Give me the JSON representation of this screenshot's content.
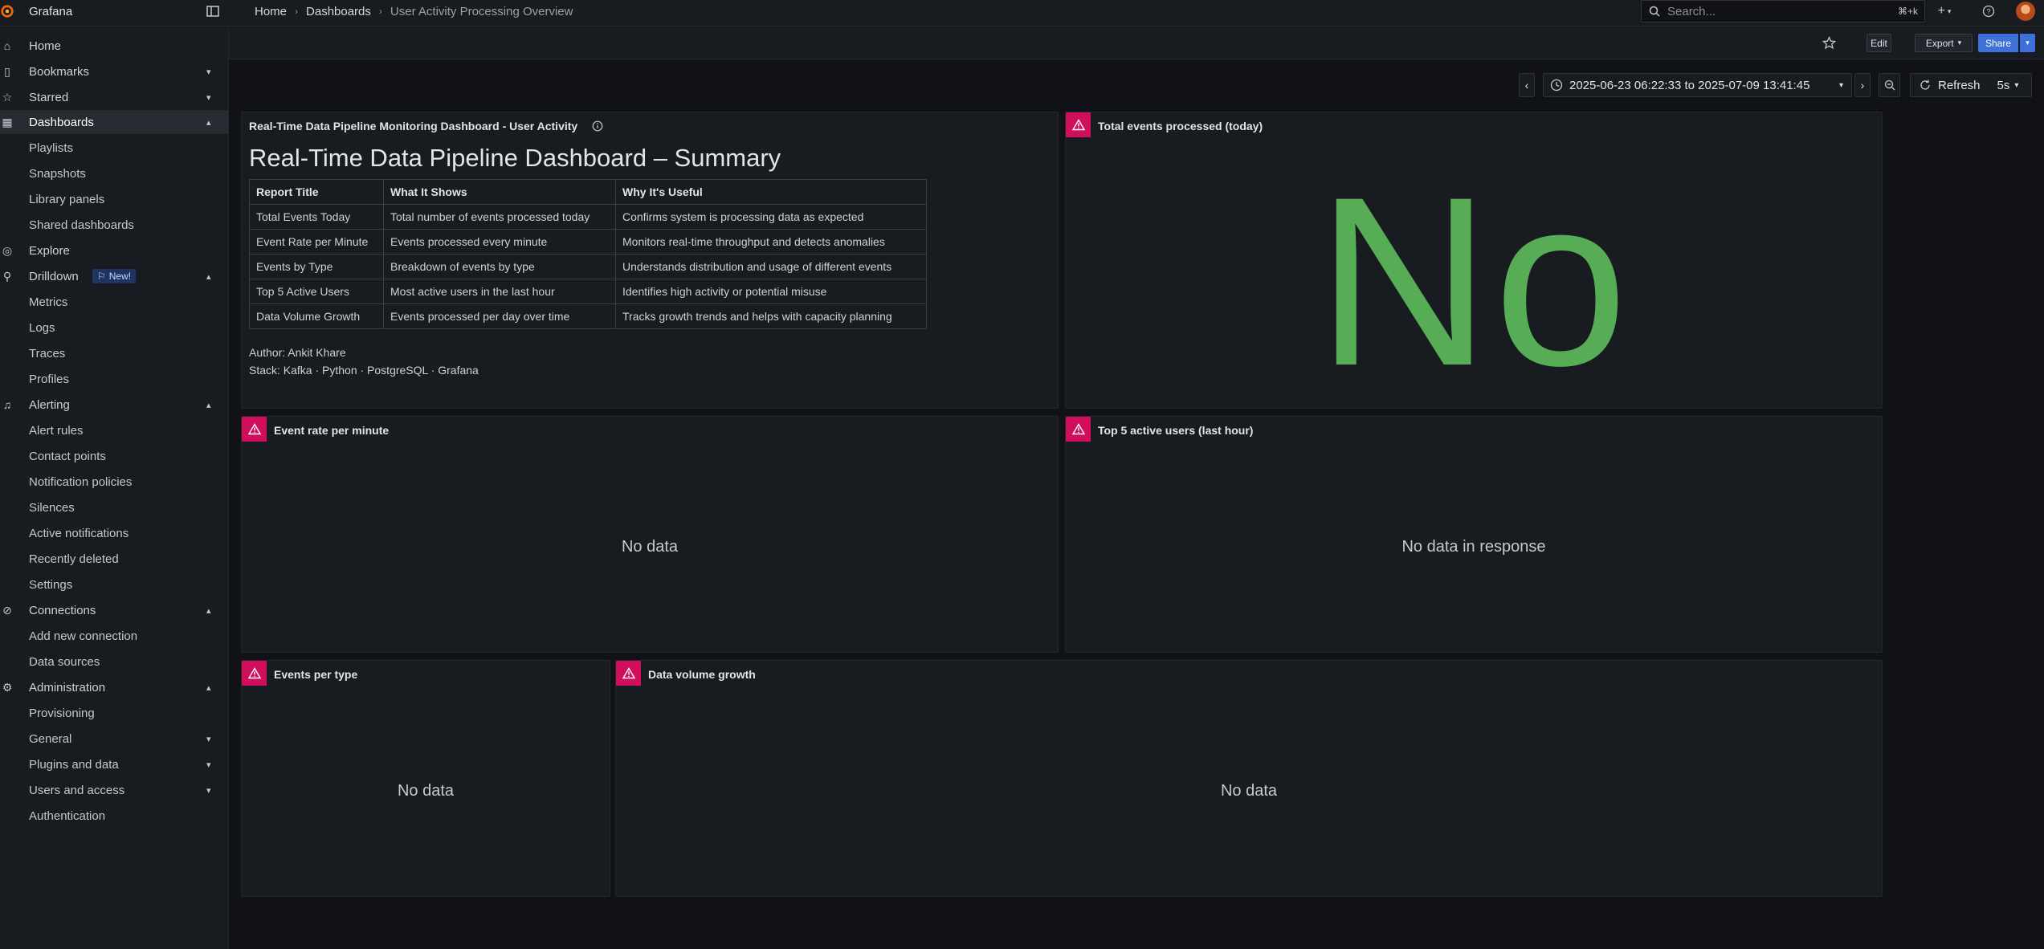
{
  "app": {
    "name": "Grafana"
  },
  "breadcrumbs": [
    "Home",
    "Dashboards",
    "User Activity Processing Overview"
  ],
  "search": {
    "placeholder": "Search...",
    "shortcut": "⌘+k"
  },
  "toolbar": {
    "edit_label": "Edit",
    "export_label": "Export",
    "share_label": "Share"
  },
  "time_range": {
    "label": "2025-06-23 06:22:33 to 2025-07-09 13:41:45"
  },
  "refresh": {
    "label": "Refresh",
    "interval": "5s"
  },
  "sidebar": {
    "items": [
      {
        "label": "Home"
      },
      {
        "label": "Bookmarks"
      },
      {
        "label": "Starred"
      },
      {
        "label": "Dashboards"
      },
      {
        "label": "Playlists"
      },
      {
        "label": "Snapshots"
      },
      {
        "label": "Library panels"
      },
      {
        "label": "Shared dashboards"
      },
      {
        "label": "Explore"
      },
      {
        "label": "Drilldown",
        "badge": "New!"
      },
      {
        "label": "Metrics"
      },
      {
        "label": "Logs"
      },
      {
        "label": "Traces"
      },
      {
        "label": "Profiles"
      },
      {
        "label": "Alerting"
      },
      {
        "label": "Alert rules"
      },
      {
        "label": "Contact points"
      },
      {
        "label": "Notification policies"
      },
      {
        "label": "Silences"
      },
      {
        "label": "Active notifications"
      },
      {
        "label": "Recently deleted"
      },
      {
        "label": "Settings"
      },
      {
        "label": "Connections"
      },
      {
        "label": "Add new connection"
      },
      {
        "label": "Data sources"
      },
      {
        "label": "Administration"
      },
      {
        "label": "Provisioning"
      },
      {
        "label": "General"
      },
      {
        "label": "Plugins and data"
      },
      {
        "label": "Users and access"
      },
      {
        "label": "Authentication"
      }
    ]
  },
  "panels": {
    "summary": {
      "title": "Real-Time Data Pipeline Monitoring Dashboard - User Activity",
      "heading": "Real-Time Data Pipeline Dashboard – Summary",
      "columns": [
        "Report Title",
        "What It Shows",
        "Why It's Useful"
      ],
      "rows": [
        [
          "Total Events Today",
          "Total number of events processed today",
          "Confirms system is processing data as expected"
        ],
        [
          "Event Rate per Minute",
          "Events processed every minute",
          "Monitors real-time throughput and detects anomalies"
        ],
        [
          "Events by Type",
          "Breakdown of events by type",
          "Understands distribution and usage of different events"
        ],
        [
          "Top 5 Active Users",
          "Most active users in the last hour",
          "Identifies high activity or potential misuse"
        ],
        [
          "Data Volume Growth",
          "Events processed per day over time",
          "Tracks growth trends and helps with capacity planning"
        ]
      ],
      "author": "Author: Ankit Khare",
      "stack": "Stack: Kafka · Python · PostgreSQL · Grafana"
    },
    "total_events": {
      "title": "Total events processed (today)",
      "value": "No data"
    },
    "event_rate": {
      "title": "Event rate per minute",
      "message": "No data"
    },
    "top_users": {
      "title": "Top 5 active users (last hour)",
      "message": "No data in response"
    },
    "events_type": {
      "title": "Events per type",
      "message": "No data"
    },
    "volume_growth": {
      "title": "Data volume growth",
      "message": "No data"
    }
  },
  "colors": {
    "accent": "#3d71d9",
    "error": "#d10e5c",
    "stat_green": "#56ad55"
  }
}
